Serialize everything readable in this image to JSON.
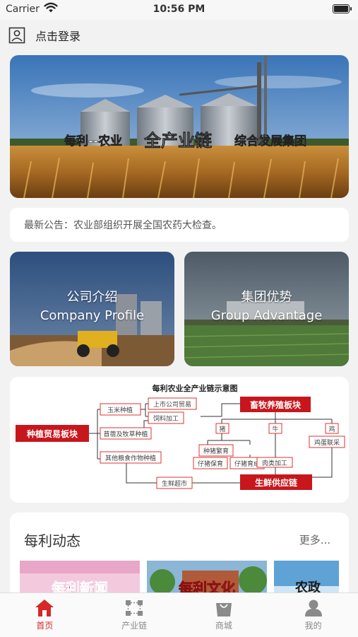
{
  "status_bar": {
    "carrier": "Carrier",
    "time": "10:56 PM"
  },
  "header": {
    "login_label": "点击登录"
  },
  "banner": {
    "slogan_a": "每利--农业",
    "slogan_b": "全产业链",
    "slogan_c": "综合发展集团"
  },
  "notice": {
    "text": "最新公告：农业部组织开展全国农药大检查。"
  },
  "cards": {
    "profile": {
      "title": "公司介绍",
      "subtitle": "Company Profile"
    },
    "advantage": {
      "title": "集团优势",
      "subtitle": "Group Advantage"
    }
  },
  "chain_diagram": {
    "title": "每利农业全产业链示意图",
    "planting": "种植贸易板块",
    "corn": "玉米种植",
    "forage": "苜蓿及牧草种植",
    "other_crops": "其他粮食作物种植",
    "listed_trade": "上市公司贸易",
    "feed_proc": "饲料加工",
    "livestock": "畜牧养殖板块",
    "pig": "猪",
    "cattle": "牛",
    "chicken": "鸡",
    "pig_breed": "种猪繁育",
    "piglet_care": "仔猪保育",
    "piglet_grow": "仔猪育成",
    "meat_proc": "肉类加工",
    "egg_contract": "鸡蛋联采",
    "fresh_supply": "生鲜供应链",
    "fresh_market": "生鲜超市"
  },
  "news": {
    "title": "每利动态",
    "more": "更多...",
    "thumbs": [
      "每利新闻",
      "每利文化",
      "农政"
    ]
  },
  "tabs": [
    {
      "label": "首页",
      "icon": "home-icon",
      "active": true
    },
    {
      "label": "产业链",
      "icon": "chain-icon",
      "active": false
    },
    {
      "label": "商城",
      "icon": "shopping-bag-icon",
      "active": false
    },
    {
      "label": "我的",
      "icon": "user-icon",
      "active": false
    }
  ],
  "colors": {
    "accent": "#d62828",
    "background": "#f2f2f2"
  }
}
